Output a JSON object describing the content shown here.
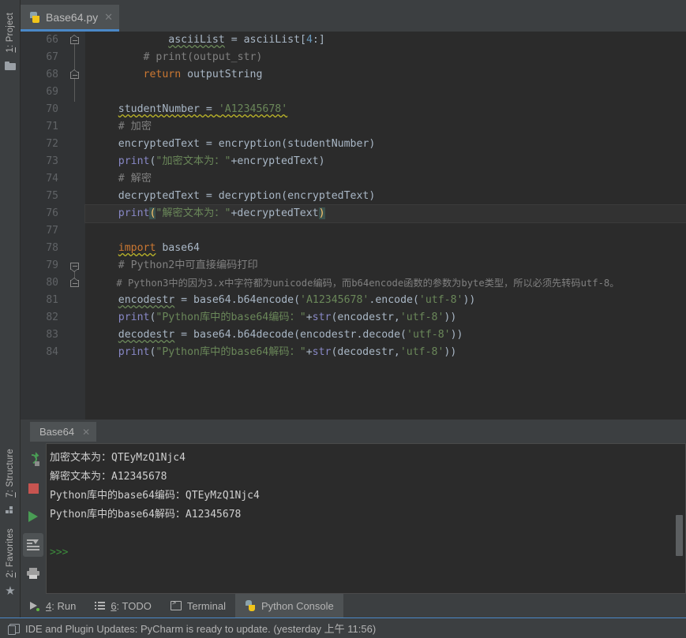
{
  "app": {
    "title": "PyCharm"
  },
  "left_rail": {
    "top_items": [
      {
        "label_prefix": "1",
        "label_suffix": ": Project",
        "icon": "folder-icon"
      }
    ],
    "bottom_items": [
      {
        "label_prefix": "7",
        "label_suffix": ": Structure",
        "icon": "structure-icon"
      },
      {
        "label_prefix": "2",
        "label_suffix": ": Favorites",
        "icon": "star-icon"
      },
      {
        "label_prefix": "",
        "label_suffix": "",
        "icon": "window-icon"
      }
    ]
  },
  "editor": {
    "tab": {
      "title": "Base64.py",
      "close_glyph": "✕",
      "icon": "python-file-icon",
      "active_underline_color": "#4a88c7"
    },
    "first_line_number": 66,
    "current_line_number": 76,
    "lines": [
      {
        "n": 66,
        "fold": "end-up",
        "text": "            asciiList = asciiList[4:]"
      },
      {
        "n": 67,
        "fold": "none",
        "text": "        # print(output_str)"
      },
      {
        "n": 68,
        "fold": "end-up",
        "text": "        return outputString"
      },
      {
        "n": 69,
        "fold": "none",
        "text": ""
      },
      {
        "n": 70,
        "fold": "none",
        "text": "    studentNumber = 'A12345678'"
      },
      {
        "n": 71,
        "fold": "none",
        "text": "    # 加密"
      },
      {
        "n": 72,
        "fold": "none",
        "text": "    encryptedText = encryption(studentNumber)"
      },
      {
        "n": 73,
        "fold": "none",
        "text": "    print(\"加密文本为：\"+encryptedText)"
      },
      {
        "n": 74,
        "fold": "none",
        "text": "    # 解密"
      },
      {
        "n": 75,
        "fold": "none",
        "text": "    decryptedText = decryption(encryptedText)"
      },
      {
        "n": 76,
        "fold": "none",
        "text": "    print(\"解密文本为：\"+decryptedText)"
      },
      {
        "n": 77,
        "fold": "none",
        "text": ""
      },
      {
        "n": 78,
        "fold": "none",
        "text": "    import base64"
      },
      {
        "n": 79,
        "fold": "start",
        "text": "    # Python2中可直接编码打印"
      },
      {
        "n": 80,
        "fold": "end-up",
        "text": "    # Python3中的因为3.x中字符都为unicode编码，而b64encode函数的参数为byte类型，所以必须先转码utf-8。"
      },
      {
        "n": 81,
        "fold": "none",
        "text": "    encodestr = base64.b64encode('A12345678'.encode('utf-8'))"
      },
      {
        "n": 82,
        "fold": "none",
        "text": "    print(\"Python库中的base64编码：\"+str(encodestr,'utf-8'))"
      },
      {
        "n": 83,
        "fold": "none",
        "text": "    decodestr = base64.b64decode(encodestr.decode('utf-8'))"
      },
      {
        "n": 84,
        "fold": "none",
        "text": "    print(\"Python库中的base64解码：\"+str(decodestr,'utf-8'))"
      }
    ]
  },
  "console": {
    "tab": {
      "title": "Base64",
      "close_glyph": "✕"
    },
    "toolbar": [
      {
        "name": "rerun-icon",
        "label": "Rerun",
        "active": false
      },
      {
        "name": "stop-icon",
        "label": "Stop",
        "active": false
      },
      {
        "name": "run-icon",
        "label": "Run",
        "active": false
      },
      {
        "name": "scroll-to-end-icon",
        "label": "Scroll to End",
        "active": true
      },
      {
        "name": "print-icon",
        "label": "Print",
        "active": false
      },
      {
        "name": "more-icon",
        "label": "»",
        "active": false
      }
    ],
    "output": [
      "加密文本为：QTEyMzQ1Njc4",
      "解密文本为：A12345678",
      "Python库中的base64编码：QTEyMzQ1Njc4",
      "Python库中的base64解码：A12345678"
    ],
    "prompt": ">>>"
  },
  "bottom_bar": {
    "items": [
      {
        "accel": "4",
        "label": ": Run",
        "icon": "run-small-icon",
        "active": false
      },
      {
        "accel": "6",
        "label": ": TODO",
        "icon": "todo-icon",
        "active": false
      },
      {
        "accel": "",
        "label": "Terminal",
        "icon": "terminal-icon",
        "active": false
      },
      {
        "accel": "",
        "label": "Python Console",
        "icon": "python-console-icon",
        "active": true
      }
    ]
  },
  "status_bar": {
    "icon": "window-icon",
    "message": "IDE and Plugin Updates: PyCharm is ready to update. (yesterday 上午 11:56)"
  },
  "colors": {
    "editor_bg": "#2b2b2b",
    "panel_bg": "#3c3f41",
    "gutter_bg": "#313335",
    "accent_blue": "#4a88c7",
    "keyword_orange": "#cc7832",
    "string_green": "#6a8759",
    "number_blue": "#6897bb",
    "comment_gray": "#808080",
    "function_violet": "#8888c6",
    "text_default": "#a9b7c6",
    "run_green": "#499c54",
    "stop_red": "#c75450"
  }
}
